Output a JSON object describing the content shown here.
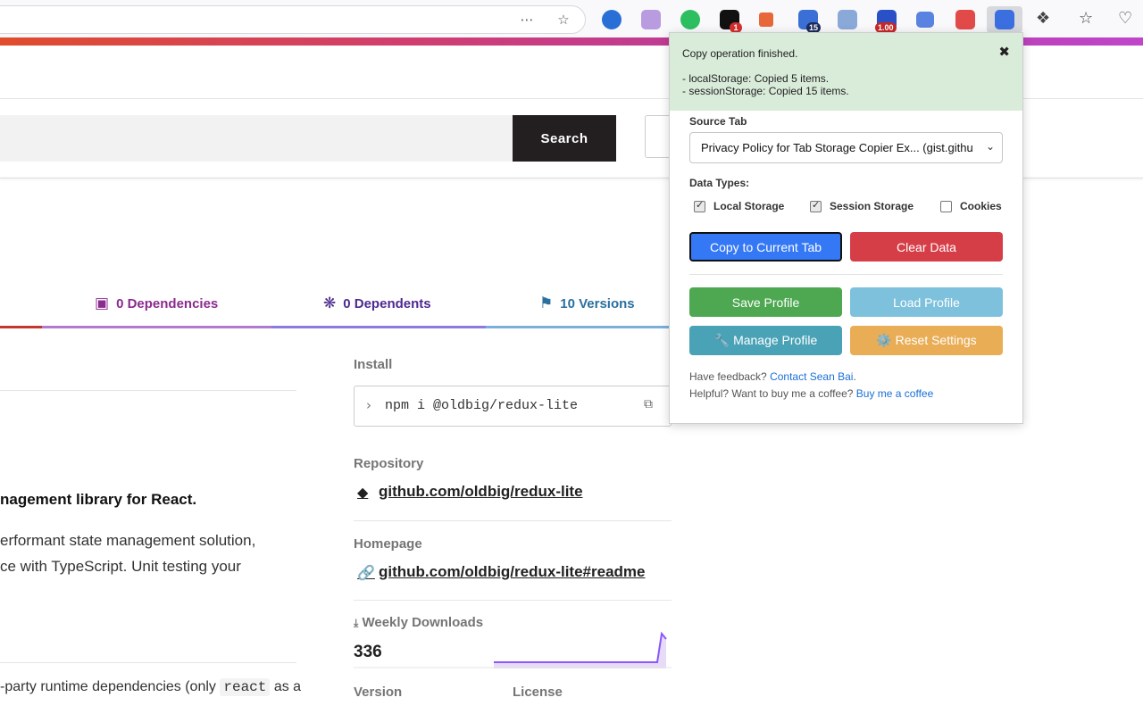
{
  "browser": {
    "icons": [
      "reader-mode-icon",
      "bookmark-star-icon"
    ],
    "extensions": [
      {
        "name": "extension-1-icon",
        "color": "#2a6fd6"
      },
      {
        "name": "extension-2-icon",
        "color": "#b99be0"
      },
      {
        "name": "evernote-icon",
        "color": "#2dbe60"
      },
      {
        "name": "extension-4-icon",
        "color": "#111111",
        "badge": "1",
        "badge_color": "#d32f2f"
      },
      {
        "name": "extension-5-icon",
        "color": "#e8673a"
      },
      {
        "name": "extension-6-icon",
        "color": "#3a6fd6",
        "badge": "15",
        "badge_color": "#1b2a5c"
      },
      {
        "name": "extension-7-icon",
        "color": "#8aa8d8"
      },
      {
        "name": "extension-8-icon",
        "color": "#2a50c8",
        "badge": "1.00",
        "badge_color": "#c62828"
      },
      {
        "name": "extension-9-icon",
        "color": "#5a82e0"
      },
      {
        "name": "extension-10-icon",
        "color": "#e24a4a"
      },
      {
        "name": "tab-storage-copier-icon",
        "color": "#3b6fe0"
      }
    ],
    "right_icons": [
      "extensions-puzzle-icon",
      "favorites-icon",
      "health-icon"
    ]
  },
  "header": {
    "search_button": "Search"
  },
  "tabs": [
    {
      "label": "0 Dependencies",
      "color": "#8b2a8f",
      "icon": "cube-icon"
    },
    {
      "label": "0 Dependents",
      "color": "#4d2a8f",
      "icon": "cubes-icon"
    },
    {
      "label": "10 Versions",
      "color": "#2a6f9f",
      "icon": "tags-icon"
    }
  ],
  "readme": {
    "heading": "nagement library for React.",
    "line1": "erformant state management solution,",
    "line2": "ce with TypeScript. Unit testing your",
    "line3_pre": "-party runtime dependencies (only ",
    "line3_code": "react",
    "line3_post": " as a"
  },
  "sidebar": {
    "install_label": "Install",
    "install_cmd": "npm i @oldbig/redux-lite",
    "repository_label": "Repository",
    "repository_link": "github.com/oldbig/redux-lite",
    "homepage_label": "Homepage",
    "homepage_link": "github.com/oldbig/redux-lite#readme",
    "downloads_label": "Weekly Downloads",
    "downloads_value": "336",
    "version_label": "Version",
    "license_label": "License"
  },
  "popup": {
    "notice_title": "Copy operation finished.",
    "notice_line1": "- localStorage: Copied 5 items.",
    "notice_line2": "- sessionStorage: Copied 15 items.",
    "source_tab_label": "Source Tab",
    "source_tab_value": "Privacy Policy for Tab Storage Copier Ex... (gist.githu",
    "data_types_label": "Data Types:",
    "checkboxes": [
      {
        "label": "Local Storage",
        "checked": true
      },
      {
        "label": "Session Storage",
        "checked": true
      },
      {
        "label": "Cookies",
        "checked": false
      }
    ],
    "buttons": {
      "copy": "Copy to Current Tab",
      "clear": "Clear Data",
      "save": "Save Profile",
      "load": "Load Profile",
      "manage": "🔧 Manage Profile",
      "reset": "⚙️ Reset Settings"
    },
    "button_colors": {
      "copy": "#3478f6",
      "clear": "#d63e47",
      "save": "#4ea852",
      "load": "#7dc1dc",
      "manage": "#4aa2b6",
      "reset": "#e9ad55"
    },
    "feedback_text": "Have feedback? ",
    "feedback_link": "Contact Sean Bai",
    "feedback_end": ".",
    "coffee_text": "Helpful? Want to buy me a coffee? ",
    "coffee_link": "Buy me a coffee"
  }
}
